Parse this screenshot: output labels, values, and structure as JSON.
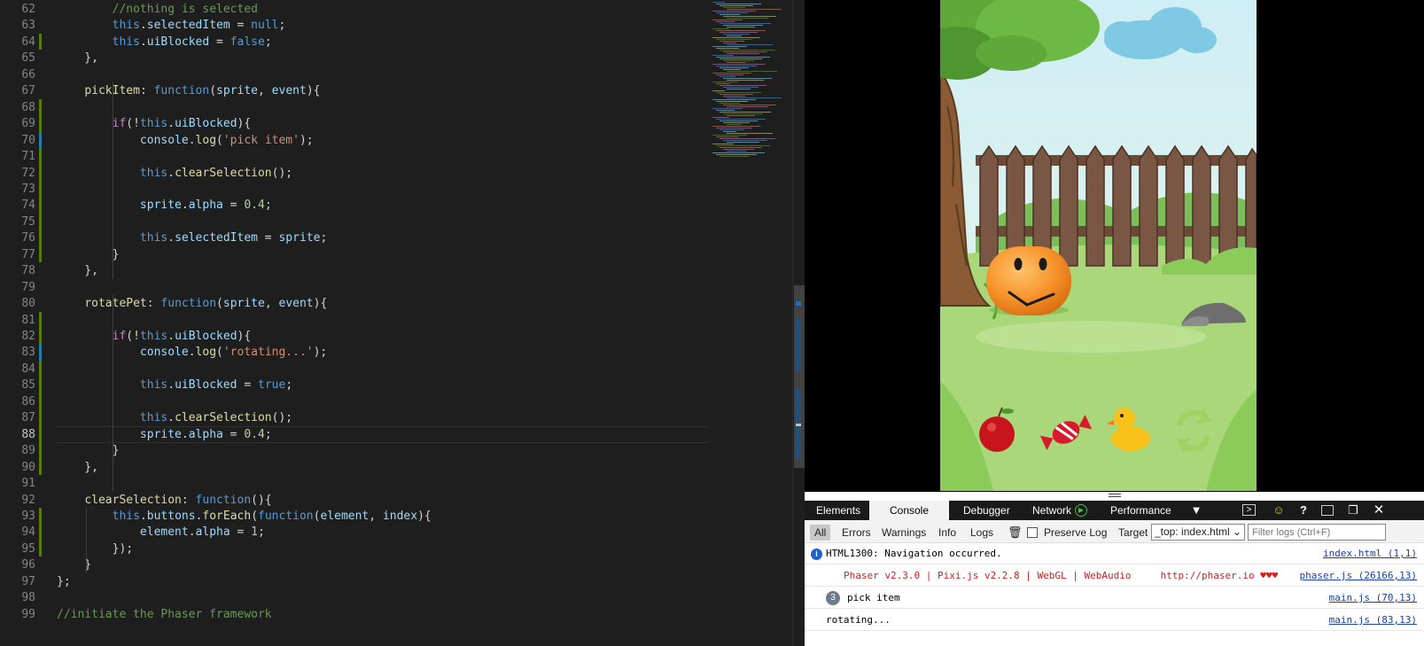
{
  "editor": {
    "lines": [
      {
        "n": "62",
        "t": [
          [
            "        ",
            "c-pun"
          ],
          [
            "//nothing is selected",
            "c-cmt"
          ]
        ]
      },
      {
        "n": "63",
        "t": [
          [
            "        ",
            "c-pun"
          ],
          [
            "this",
            "c-kw"
          ],
          [
            ".",
            "c-pun"
          ],
          [
            "selectedItem",
            "c-prop"
          ],
          [
            " = ",
            "c-pun"
          ],
          [
            "null",
            "c-kw"
          ],
          [
            ";",
            "c-pun"
          ]
        ]
      },
      {
        "n": "64",
        "t": [
          [
            "        ",
            "c-pun"
          ],
          [
            "this",
            "c-kw"
          ],
          [
            ".",
            "c-pun"
          ],
          [
            "uiBlocked",
            "c-prop"
          ],
          [
            " = ",
            "c-pun"
          ],
          [
            "false",
            "c-kw"
          ],
          [
            ";",
            "c-pun"
          ]
        ]
      },
      {
        "n": "65",
        "t": [
          [
            "    },",
            "c-pun"
          ]
        ]
      },
      {
        "n": "66",
        "t": []
      },
      {
        "n": "67",
        "t": [
          [
            "    ",
            "c-pun"
          ],
          [
            "pickItem",
            "c-fn"
          ],
          [
            ": ",
            "c-pun"
          ],
          [
            "function",
            "c-kw"
          ],
          [
            "(",
            "c-pun"
          ],
          [
            "sprite",
            "c-prop"
          ],
          [
            ", ",
            "c-pun"
          ],
          [
            "event",
            "c-prop"
          ],
          [
            "){",
            "c-pun"
          ]
        ]
      },
      {
        "n": "68",
        "t": []
      },
      {
        "n": "69",
        "t": [
          [
            "        ",
            "c-pun"
          ],
          [
            "if",
            "c-ctl"
          ],
          [
            "(!",
            "c-pun"
          ],
          [
            "this",
            "c-kw"
          ],
          [
            ".",
            "c-pun"
          ],
          [
            "uiBlocked",
            "c-prop"
          ],
          [
            "){",
            "c-pun"
          ]
        ]
      },
      {
        "n": "70",
        "t": [
          [
            "            ",
            "c-pun"
          ],
          [
            "console",
            "c-prop"
          ],
          [
            ".",
            "c-pun"
          ],
          [
            "log",
            "c-fn"
          ],
          [
            "(",
            "c-pun"
          ],
          [
            "'pick item'",
            "c-str"
          ],
          [
            ");",
            "c-pun"
          ]
        ]
      },
      {
        "n": "71",
        "t": []
      },
      {
        "n": "72",
        "t": [
          [
            "            ",
            "c-pun"
          ],
          [
            "this",
            "c-kw"
          ],
          [
            ".",
            "c-pun"
          ],
          [
            "clearSelection",
            "c-fn"
          ],
          [
            "();",
            "c-pun"
          ]
        ]
      },
      {
        "n": "73",
        "t": []
      },
      {
        "n": "74",
        "t": [
          [
            "            ",
            "c-pun"
          ],
          [
            "sprite",
            "c-prop"
          ],
          [
            ".",
            "c-pun"
          ],
          [
            "alpha",
            "c-prop"
          ],
          [
            " = ",
            "c-pun"
          ],
          [
            "0.4",
            "c-num"
          ],
          [
            ";",
            "c-pun"
          ]
        ]
      },
      {
        "n": "75",
        "t": []
      },
      {
        "n": "76",
        "t": [
          [
            "            ",
            "c-pun"
          ],
          [
            "this",
            "c-kw"
          ],
          [
            ".",
            "c-pun"
          ],
          [
            "selectedItem",
            "c-prop"
          ],
          [
            " = ",
            "c-pun"
          ],
          [
            "sprite",
            "c-prop"
          ],
          [
            ";",
            "c-pun"
          ]
        ]
      },
      {
        "n": "77",
        "t": [
          [
            "        }",
            "c-pun"
          ]
        ]
      },
      {
        "n": "78",
        "t": [
          [
            "    },",
            "c-pun"
          ]
        ]
      },
      {
        "n": "79",
        "t": []
      },
      {
        "n": "80",
        "t": [
          [
            "    ",
            "c-pun"
          ],
          [
            "rotatePet",
            "c-fn"
          ],
          [
            ": ",
            "c-pun"
          ],
          [
            "function",
            "c-kw"
          ],
          [
            "(",
            "c-pun"
          ],
          [
            "sprite",
            "c-prop"
          ],
          [
            ", ",
            "c-pun"
          ],
          [
            "event",
            "c-prop"
          ],
          [
            "){",
            "c-pun"
          ]
        ]
      },
      {
        "n": "81",
        "t": []
      },
      {
        "n": "82",
        "t": [
          [
            "        ",
            "c-pun"
          ],
          [
            "if",
            "c-ctl"
          ],
          [
            "(!",
            "c-pun"
          ],
          [
            "this",
            "c-kw"
          ],
          [
            ".",
            "c-pun"
          ],
          [
            "uiBlocked",
            "c-prop"
          ],
          [
            "){",
            "c-pun"
          ]
        ]
      },
      {
        "n": "83",
        "t": [
          [
            "            ",
            "c-pun"
          ],
          [
            "console",
            "c-prop"
          ],
          [
            ".",
            "c-pun"
          ],
          [
            "log",
            "c-fn"
          ],
          [
            "(",
            "c-pun"
          ],
          [
            "'rotating...'",
            "c-str"
          ],
          [
            ");",
            "c-pun"
          ]
        ]
      },
      {
        "n": "84",
        "t": []
      },
      {
        "n": "85",
        "t": [
          [
            "            ",
            "c-pun"
          ],
          [
            "this",
            "c-kw"
          ],
          [
            ".",
            "c-pun"
          ],
          [
            "uiBlocked",
            "c-prop"
          ],
          [
            " = ",
            "c-pun"
          ],
          [
            "true",
            "c-kw"
          ],
          [
            ";",
            "c-pun"
          ]
        ]
      },
      {
        "n": "86",
        "t": []
      },
      {
        "n": "87",
        "t": [
          [
            "            ",
            "c-pun"
          ],
          [
            "this",
            "c-kw"
          ],
          [
            ".",
            "c-pun"
          ],
          [
            "clearSelection",
            "c-fn"
          ],
          [
            "();",
            "c-pun"
          ]
        ]
      },
      {
        "n": "88",
        "t": [
          [
            "            ",
            "c-pun"
          ],
          [
            "sprite",
            "c-prop"
          ],
          [
            ".",
            "c-pun"
          ],
          [
            "alpha",
            "c-prop"
          ],
          [
            " = ",
            "c-pun"
          ],
          [
            "0.4",
            "c-num"
          ],
          [
            ";",
            "c-pun"
          ]
        ]
      },
      {
        "n": "89",
        "t": [
          [
            "        }",
            "c-pun"
          ]
        ]
      },
      {
        "n": "90",
        "t": [
          [
            "    },",
            "c-pun"
          ]
        ]
      },
      {
        "n": "91",
        "t": []
      },
      {
        "n": "92",
        "t": [
          [
            "    ",
            "c-pun"
          ],
          [
            "clearSelection",
            "c-fn"
          ],
          [
            ": ",
            "c-pun"
          ],
          [
            "function",
            "c-kw"
          ],
          [
            "(){",
            "c-pun"
          ]
        ]
      },
      {
        "n": "93",
        "t": [
          [
            "        ",
            "c-pun"
          ],
          [
            "this",
            "c-kw"
          ],
          [
            ".",
            "c-pun"
          ],
          [
            "buttons",
            "c-prop"
          ],
          [
            ".",
            "c-pun"
          ],
          [
            "forEach",
            "c-fn"
          ],
          [
            "(",
            "c-pun"
          ],
          [
            "function",
            "c-kw"
          ],
          [
            "(",
            "c-pun"
          ],
          [
            "element",
            "c-prop"
          ],
          [
            ", ",
            "c-pun"
          ],
          [
            "index",
            "c-prop"
          ],
          [
            "){",
            "c-pun"
          ]
        ]
      },
      {
        "n": "94",
        "t": [
          [
            "            ",
            "c-pun"
          ],
          [
            "element",
            "c-prop"
          ],
          [
            ".",
            "c-pun"
          ],
          [
            "alpha",
            "c-prop"
          ],
          [
            " = ",
            "c-pun"
          ],
          [
            "1",
            "c-num"
          ],
          [
            ";",
            "c-pun"
          ]
        ]
      },
      {
        "n": "95",
        "t": [
          [
            "        });",
            "c-pun"
          ]
        ]
      },
      {
        "n": "96",
        "t": [
          [
            "    }",
            "c-pun"
          ]
        ]
      },
      {
        "n": "97",
        "t": [
          [
            "};",
            "c-pun"
          ]
        ]
      },
      {
        "n": "98",
        "t": []
      },
      {
        "n": "99",
        "t": [
          [
            "//initiate the Phaser framework",
            "c-cmt"
          ]
        ]
      }
    ],
    "active_line": "88"
  },
  "devtools": {
    "tabs": [
      "Elements",
      "Console",
      "Debugger",
      "Network",
      "Performance"
    ],
    "selected_tab": "Console",
    "filters": [
      "All",
      "Errors",
      "Warnings",
      "Info",
      "Logs"
    ],
    "selected_filter": "All",
    "preserve_log": "Preserve Log",
    "target_label": "Target",
    "target_value": "_top: index.html",
    "filter_placeholder": "Filter logs (Ctrl+F)",
    "logs": [
      {
        "kind": "info",
        "msg": "HTML1300: Navigation occurred.",
        "src": "index.html (1,1)",
        "color": "#000000"
      },
      {
        "kind": "plain",
        "msg": "Phaser v2.3.0 | Pixi.js v2.2.8 | WebGL | WebAudio     http://phaser.io ♥♥♥",
        "src": "phaser.js (26166,13)",
        "color": "#d81b1b"
      },
      {
        "kind": "count",
        "count": "3",
        "msg": "pick item",
        "src": "main.js (70,13)",
        "color": "#000000"
      },
      {
        "kind": "plain",
        "msg": "rotating...",
        "src": "main.js (83,13)",
        "color": "#000000"
      }
    ]
  },
  "game": {
    "items": [
      "apple-icon",
      "candy-icon",
      "rubber-duck-icon",
      "rotate-icon"
    ]
  }
}
